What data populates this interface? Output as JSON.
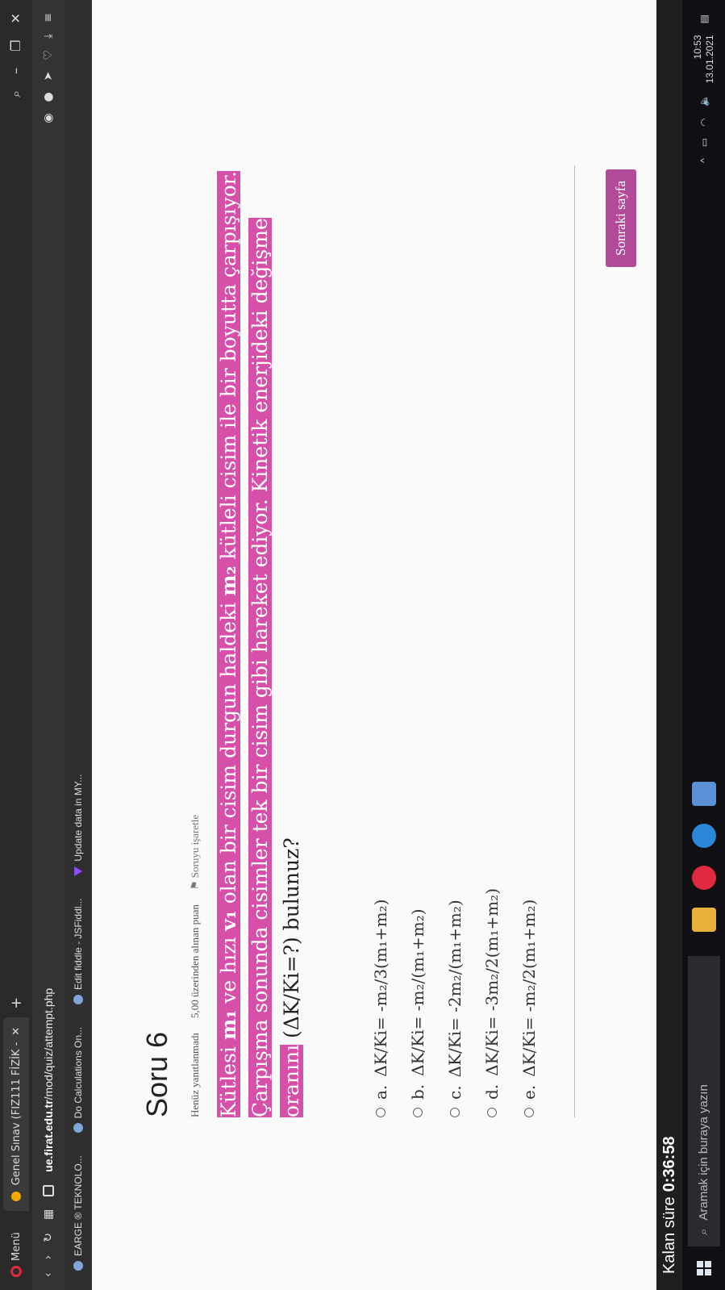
{
  "browser": {
    "menu_label": "Menü",
    "tab_title": "Genel Sınav (FIZ111 FİZİK -",
    "url_host": "ue.firat.edu.tr",
    "url_path": "/mod/quiz/attempt.php"
  },
  "bookmarks": [
    {
      "label": "EARGE ® TEKNOLO..."
    },
    {
      "label": "Do Calculations On..."
    },
    {
      "label": "Edit fiddle - JSFiddl..."
    },
    {
      "label": "Update data in MY..."
    }
  ],
  "question": {
    "title": "Soru 6",
    "status": "Henüz yanıtlanmadı",
    "points": "5,00 üzerinden alınan puan",
    "flag_label": "Soruyu işaretle",
    "text_parts": [
      "Kütlesi ",
      "m₁",
      " ve hızı ",
      "v₁",
      " olan bir cisim durgun haldeki ",
      "m₂",
      " kütleli cisim ile bir boyutta çarpışıyor. Çarpışma sonunda cisimler tek bir cisim gibi hareket ediyor. Kinetik enerjideki değişme oranını",
      " (ΔK/Ki=?) bulunuz?"
    ],
    "options": [
      {
        "letter": "a.",
        "text": "ΔK/Ki= -m₂/3(m₁+m₂)"
      },
      {
        "letter": "b.",
        "text": "ΔK/Ki= -m₂/(m₁+m₂)"
      },
      {
        "letter": "c.",
        "text": "ΔK/Ki= -2m₂/(m₁+m₂)"
      },
      {
        "letter": "d.",
        "text": "ΔK/Ki= -3m₂/2(m₁+m₂)"
      },
      {
        "letter": "e.",
        "text": "ΔK/Ki= -m₂/2(m₁+m₂)"
      }
    ],
    "next_label": "Sonraki sayfa"
  },
  "timer": {
    "label": "Kalan süre",
    "value": "0:36:58"
  },
  "taskbar": {
    "search_placeholder": "Aramak için buraya yazın",
    "time": "10:53",
    "date": "13.01.2021"
  },
  "colors": {
    "highlight": "#d64fa9",
    "button": "#b24a9a"
  }
}
